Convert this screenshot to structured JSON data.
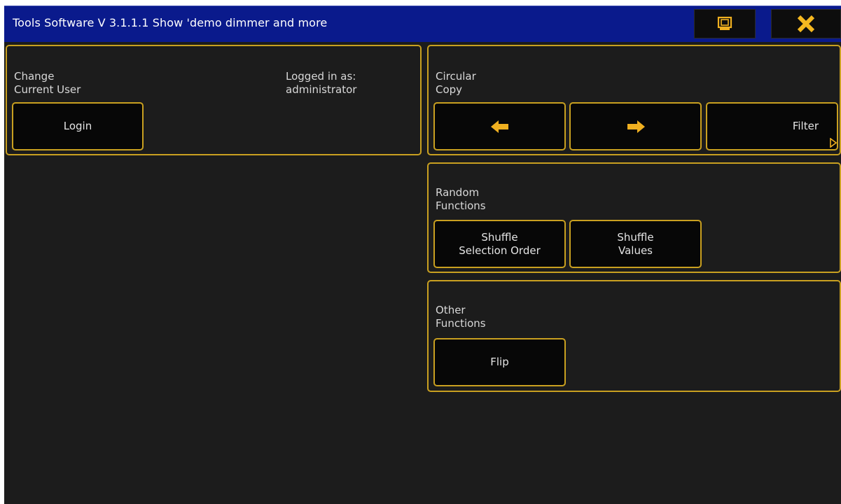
{
  "titlebar": {
    "title": "Tools  Software V 3.1.1.1  Show 'demo dimmer and more",
    "screen_icon": "monitor-icon",
    "close_icon": "close-icon"
  },
  "user_panel": {
    "label_line1": "Change",
    "label_line2": "Current User",
    "logged_in_line1": "Logged in as:",
    "logged_in_line2": "administrator",
    "login_button": "Login"
  },
  "circular_copy": {
    "label_line1": "Circular",
    "label_line2": "Copy",
    "left_icon": "arrow-left-icon",
    "right_icon": "arrow-right-icon",
    "filter_button": "Filter"
  },
  "random_functions": {
    "label_line1": "Random",
    "label_line2": "Functions",
    "shuffle_order_line1": "Shuffle",
    "shuffle_order_line2": "Selection Order",
    "shuffle_values_line1": "Shuffle",
    "shuffle_values_line2": "Values"
  },
  "other_functions": {
    "label_line1": "Other",
    "label_line2": "Functions",
    "flip_button": "Flip"
  },
  "colors": {
    "titlebar_bg": "#0a1a8c",
    "accent": "#c9a020",
    "arrow": "#f0b020",
    "close_x": "#f5b820",
    "background": "#1c1c1c"
  }
}
